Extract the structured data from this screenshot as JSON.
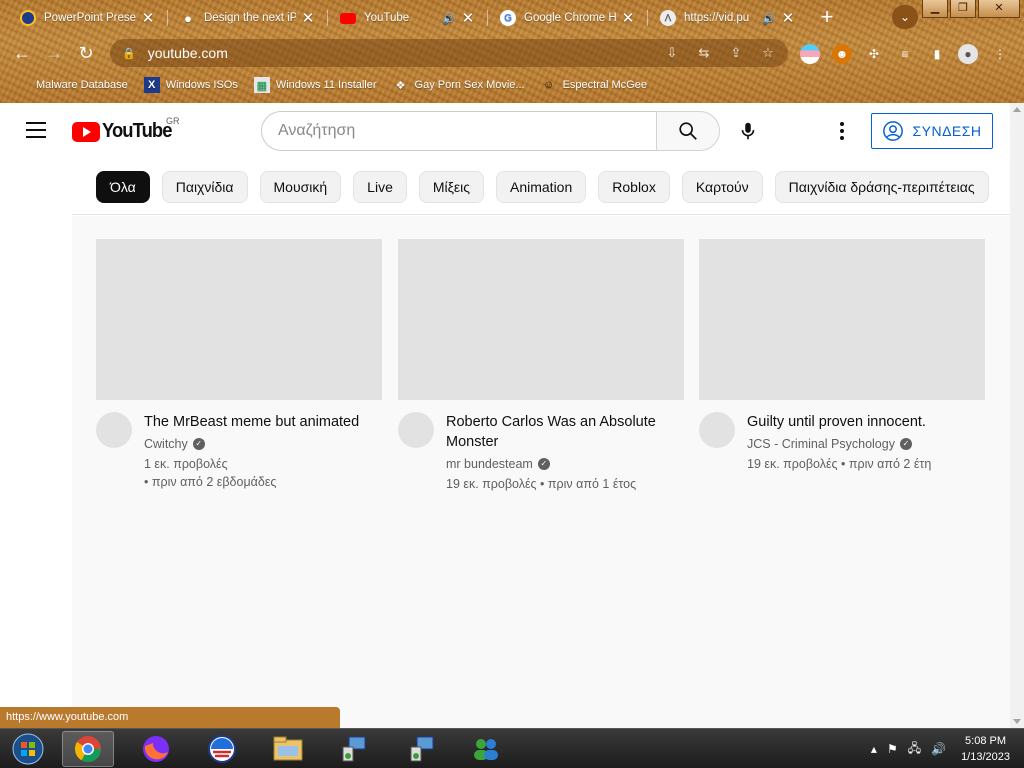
{
  "browser": {
    "tabs": [
      {
        "title": "PowerPoint Presen",
        "favicon": "powerpoint-icon",
        "audio": false
      },
      {
        "title": "Design the next iP",
        "favicon": "apple-icon",
        "audio": false
      },
      {
        "title": "YouTube",
        "favicon": "youtube-icon",
        "audio": true
      },
      {
        "title": "Google Chrome He",
        "favicon": "google-icon",
        "audio": false
      },
      {
        "title": "https://vid.pu",
        "favicon": "link-icon",
        "audio": true
      }
    ],
    "url": "youtube.com",
    "bookmarks": [
      {
        "label": "Malware Database",
        "icon": "blank-icon"
      },
      {
        "label": "Windows ISOs",
        "icon": "x-icon"
      },
      {
        "label": "Windows 11 Installer",
        "icon": "image-icon"
      },
      {
        "label": "Gay Porn Sex Movie...",
        "icon": "bookmark-icon"
      },
      {
        "label": "Espectral McGee",
        "icon": "person-icon"
      }
    ],
    "status_url": "https://www.youtube.com"
  },
  "youtube": {
    "logo_text": "YouTube",
    "country_code": "GR",
    "search_placeholder": "Αναζήτηση",
    "signin_label": "ΣΥΝΔΕΣΗ",
    "chips": [
      "Όλα",
      "Παιχνίδια",
      "Μουσική",
      "Live",
      "Μίξεις",
      "Animation",
      "Roblox",
      "Καρτούν",
      "Παιχνίδια δράσης-περιπέτειας"
    ],
    "videos": [
      {
        "title": "The MrBeast meme but animated",
        "channel": "Cwitchy",
        "stats_line1": "1 εκ. προβολές",
        "stats_line2": "• πριν από 2 εβδομάδες"
      },
      {
        "title": "Roberto Carlos Was an Absolute Monster",
        "channel": "mr bundesteam",
        "stats_line1": "19 εκ. προβολές • πριν από 1 έτος",
        "stats_line2": ""
      },
      {
        "title": "Guilty until proven innocent.",
        "channel": "JCS - Criminal Psychology",
        "stats_line1": "19 εκ. προβολές • πριν από 2 έτη",
        "stats_line2": ""
      }
    ]
  },
  "taskbar": {
    "apps": [
      "start-orb-icon",
      "chrome-icon",
      "firefox-icon",
      "obama-icon",
      "file-explorer-icon",
      "network-setup-icon",
      "network-setup-icon-2",
      "messenger-icon"
    ],
    "time": "5:08 PM",
    "date": "1/13/2023"
  },
  "colors": {
    "chrome_theme": "#b97a2e",
    "youtube_red": "#ff0000",
    "signin_blue": "#065fd4"
  }
}
